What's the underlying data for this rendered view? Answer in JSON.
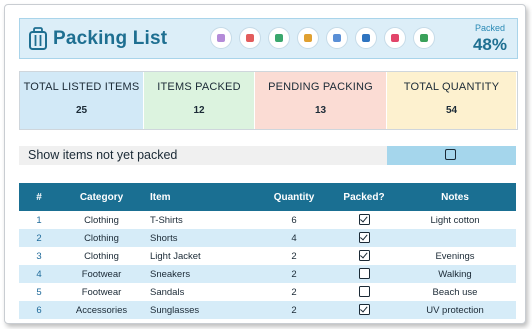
{
  "app": {
    "title": "Packing List",
    "packed_label": "Packed",
    "packed_percent": "48%"
  },
  "toolbar": [
    {
      "name": "settings-icon",
      "color": "#b48bd8"
    },
    {
      "name": "airplane-icon",
      "color": "#e25c5c"
    },
    {
      "name": "globe-icon",
      "color": "#3aa76d"
    },
    {
      "name": "money-bag-icon",
      "color": "#e0a030"
    },
    {
      "name": "calendar-icon",
      "color": "#5a8fd6"
    },
    {
      "name": "clipboard-icon",
      "color": "#2f74c0"
    },
    {
      "name": "ticket-icon",
      "color": "#e2456a"
    },
    {
      "name": "tag-icon",
      "color": "#3aa15a"
    }
  ],
  "stats": [
    {
      "label": "TOTAL LISTED ITEMS",
      "value": "25",
      "bg": "#d2e9f7"
    },
    {
      "label": "ITEMS PACKED",
      "value": "12",
      "bg": "#dcf3df"
    },
    {
      "label": "PENDING PACKING",
      "value": "13",
      "bg": "#fbdcd4"
    },
    {
      "label": "TOTAL QUANTITY",
      "value": "54",
      "bg": "#fdf1cf"
    }
  ],
  "filter": {
    "label": "Show items not yet packed",
    "checked": false
  },
  "table": {
    "columns": [
      "#",
      "Category",
      "Item",
      "Quantity",
      "Packed?",
      "Notes"
    ],
    "rows": [
      {
        "num": "1",
        "category": "Clothing",
        "item": "T-Shirts",
        "quantity": "6",
        "packed": true,
        "notes": "Light cotton"
      },
      {
        "num": "2",
        "category": "Clothing",
        "item": "Shorts",
        "quantity": "4",
        "packed": true,
        "notes": ""
      },
      {
        "num": "3",
        "category": "Clothing",
        "item": "Light Jacket",
        "quantity": "2",
        "packed": true,
        "notes": "Evenings"
      },
      {
        "num": "4",
        "category": "Footwear",
        "item": "Sneakers",
        "quantity": "2",
        "packed": false,
        "notes": "Walking"
      },
      {
        "num": "5",
        "category": "Footwear",
        "item": "Sandals",
        "quantity": "2",
        "packed": false,
        "notes": "Beach use"
      },
      {
        "num": "6",
        "category": "Accessories",
        "item": "Sunglasses",
        "quantity": "2",
        "packed": true,
        "notes": "UV protection"
      }
    ]
  },
  "colors": {
    "accent": "#1e6f91",
    "table_header": "#1a6f92",
    "row_alt": "#d6ecf8",
    "filter_box": "#a5d6ec"
  }
}
